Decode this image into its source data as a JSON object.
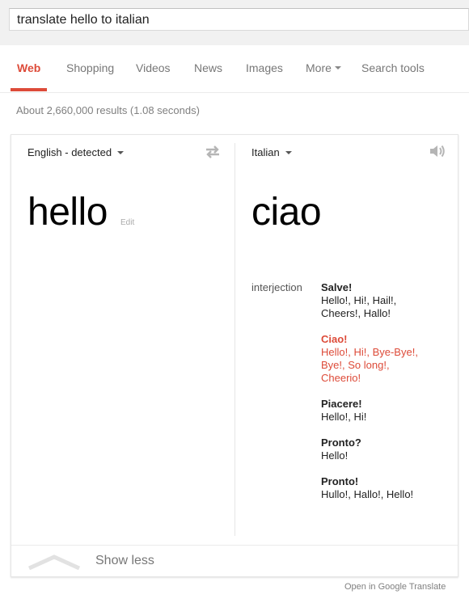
{
  "search": {
    "query": "translate hello to italian"
  },
  "tabs": [
    {
      "label": "Web",
      "active": true
    },
    {
      "label": "Shopping"
    },
    {
      "label": "Videos"
    },
    {
      "label": "News"
    },
    {
      "label": "Images"
    },
    {
      "label": "More"
    },
    {
      "label": "Search tools"
    }
  ],
  "results_info": "About 2,660,000 results (1.08 seconds)",
  "translate": {
    "source_language": "English - detected",
    "target_language": "Italian",
    "source_text": "hello",
    "edit_label": "Edit",
    "target_text": "ciao",
    "part_of_speech": "interjection",
    "entries": [
      {
        "word": "Salve!",
        "translations": [
          "Hello!, Hi!, Hail!,",
          "Cheers!, Hallo!"
        ],
        "highlight": false
      },
      {
        "word": "Ciao!",
        "translations": [
          "Hello!, Hi!, Bye-Bye!,",
          "Bye!, So long!,",
          "Cheerio!"
        ],
        "highlight": true
      },
      {
        "word": "Piacere!",
        "translations": [
          "Hello!, Hi!"
        ],
        "highlight": false
      },
      {
        "word": "Pronto?",
        "translations": [
          "Hello!"
        ],
        "highlight": false
      },
      {
        "word": "Pronto!",
        "translations": [
          "Hullo!, Hallo!, Hello!"
        ],
        "highlight": false
      }
    ],
    "show_less_label": "Show less",
    "open_link_label": "Open in Google Translate"
  },
  "colors": {
    "accent": "#dd4b39",
    "muted": "#777777",
    "topbar_bg": "#f1f1f1"
  },
  "icons": {
    "swap": "swap-arrows-icon",
    "speaker": "speaker-icon",
    "chevron": "chevron-up-icon"
  }
}
